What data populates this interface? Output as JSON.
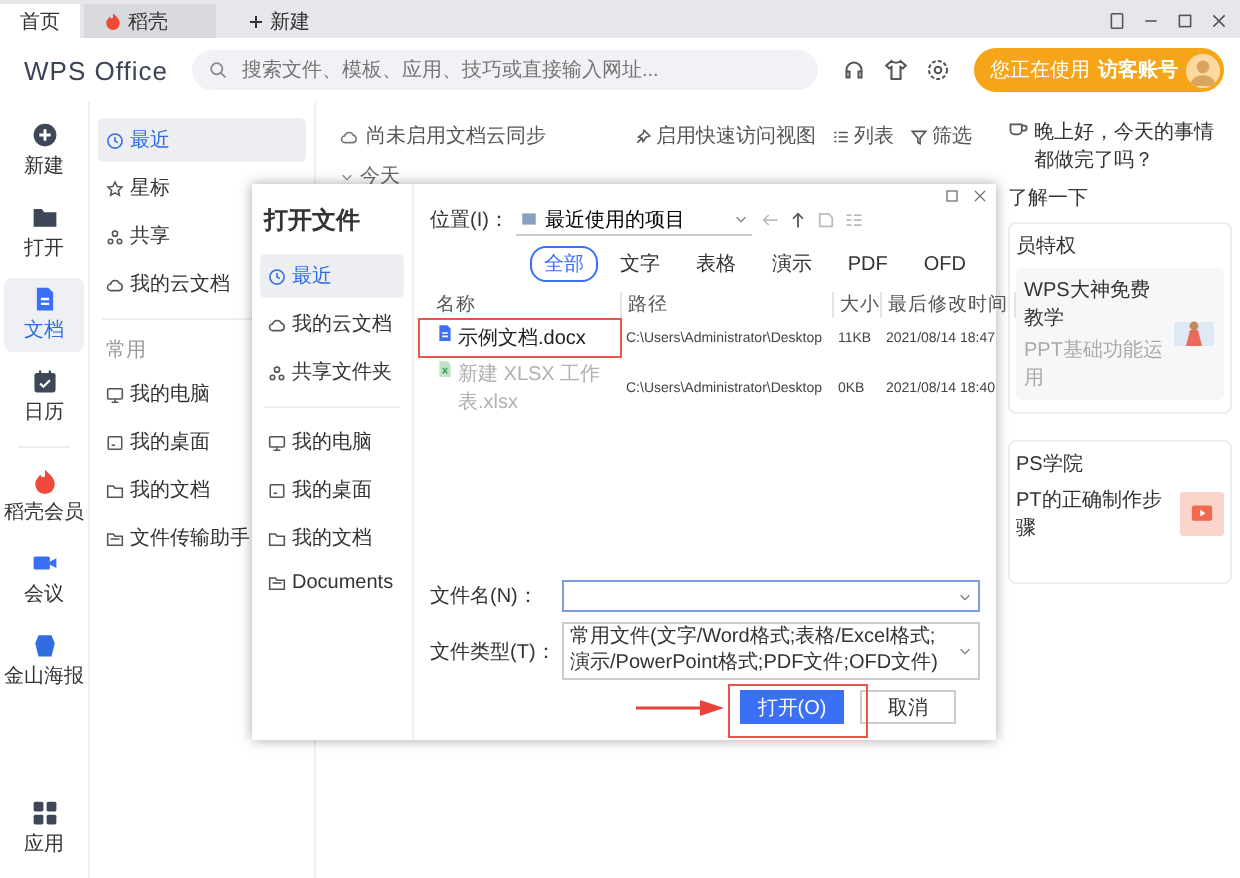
{
  "tabs": [
    {
      "label": "首页",
      "selected": true
    },
    {
      "label": "稻壳",
      "selected": false
    }
  ],
  "new_tab": "新建",
  "header": {
    "logo": "WPS Office",
    "search": {
      "placeholder": "搜索文件、模板、应用、技巧或直接输入网址..."
    },
    "account_button": "您正在使用 **访客账号**"
  },
  "rail": {
    "items": [
      {
        "label": "新建",
        "selected": false
      },
      {
        "label": "打开",
        "selected": false
      },
      {
        "label": "文档",
        "selected": true
      },
      {
        "label": "日历",
        "selected": false
      },
      {
        "label": "稻壳会员",
        "selected": false
      },
      {
        "label": "会议",
        "selected": false
      },
      {
        "label": "金山海报",
        "selected": false
      }
    ],
    "apps": "应用"
  },
  "nav": {
    "items": [
      {
        "label": "最近",
        "selected": true
      },
      {
        "label": "星标",
        "selected": false
      },
      {
        "label": "共享",
        "selected": false
      },
      {
        "label": "我的云文档",
        "selected": false
      }
    ],
    "section": "常用",
    "common": [
      "我的电脑",
      "我的桌面",
      "我的文档",
      "文件传输助手"
    ]
  },
  "main": {
    "sync_notice": "尚未启用文档云同步",
    "quick_access": "启用快速访问视图",
    "list_view": "列表",
    "filter": "筛选",
    "group": "今天"
  },
  "right_panel": {
    "greeting": "晚上好，今天的事情都做完了吗？",
    "learn_more": "了解一下",
    "cards": [
      {
        "title": "员特权",
        "headline": "WPS大神免费教学",
        "subtitle": "PPT基础功能运用"
      },
      {
        "title": "PS学院",
        "headline": "PT的正确制作步骤"
      }
    ]
  },
  "dialog": {
    "title": "打开文件",
    "places": [
      {
        "label": "最近",
        "selected": true
      },
      {
        "label": "我的云文档",
        "selected": false
      },
      {
        "label": "共享文件夹",
        "selected": false
      }
    ],
    "folders": [
      "我的电脑",
      "我的桌面",
      "我的文档",
      "Documents"
    ],
    "location_label": "位置(I)：",
    "location": "最近使用的项目",
    "filters": [
      {
        "label": "全部",
        "selected": true
      },
      {
        "label": "文字",
        "selected": false
      },
      {
        "label": "表格",
        "selected": false
      },
      {
        "label": "演示",
        "selected": false
      },
      {
        "label": "PDF",
        "selected": false
      },
      {
        "label": "OFD",
        "selected": false
      }
    ],
    "columns": [
      "名称",
      "路径",
      "大小",
      "最后修改时间"
    ],
    "files": [
      {
        "kind": "doc",
        "name": "示例文档.docx",
        "path": "C:\\Users\\Administrator\\Desktop",
        "size": "11KB",
        "modified": "2021/08/14 18:47",
        "disabled": false,
        "highlighted": true
      },
      {
        "kind": "sheet",
        "name": "新建 XLSX 工作表.xlsx",
        "path": "C:\\Users\\Administrator\\Desktop",
        "size": "0KB",
        "modified": "2021/08/14 18:40",
        "disabled": true,
        "highlighted": false
      }
    ],
    "file_name_label": "文件名(N)：",
    "file_type_label": "文件类型(T)：",
    "file_type": "常用文件(文字/Word格式;表格/Excel格式;演示/PowerPoint格式;PDF文件;OFD文件)",
    "open_button": {
      "label": "打开(O)",
      "highlighted": true
    },
    "cancel_button": "取消"
  }
}
